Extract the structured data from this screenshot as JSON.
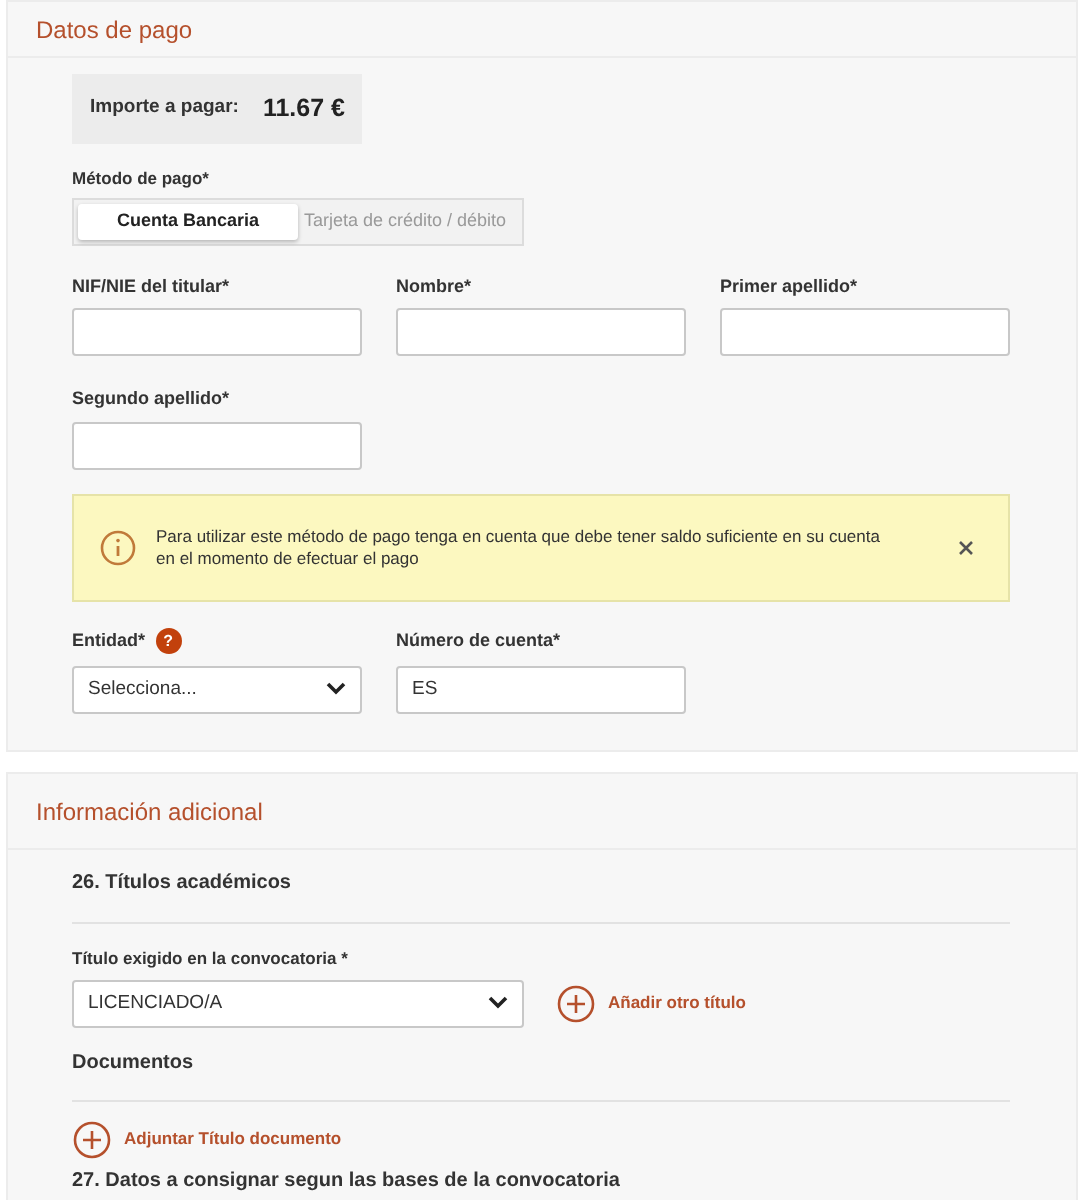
{
  "payment": {
    "title": "Datos de pago",
    "amount": {
      "label": "Importe a pagar:",
      "value": "11.67 €"
    },
    "method": {
      "label": "Método de pago*",
      "options": [
        {
          "label": "Cuenta Bancaria",
          "selected": true
        },
        {
          "label": "Tarjeta de crédito / débito",
          "selected": false
        }
      ]
    },
    "fields": [
      {
        "label": "NIF/NIE del titular*"
      },
      {
        "label": "Nombre*"
      },
      {
        "label": "Primer apellido*"
      },
      {
        "label": "Segundo apellido*"
      }
    ],
    "alert": {
      "text": "Para utilizar este método de pago tenga en cuenta que debe tener saldo suficiente en su cuenta en el momento de efectuar el pago"
    },
    "entity": {
      "label": "Entidad*",
      "help": "?",
      "value": "Selecciona..."
    },
    "account": {
      "label": "Número de cuenta*",
      "value": "ES"
    }
  },
  "additional": {
    "title": "Información adicional",
    "section_26": "26. Títulos académicos",
    "degree": {
      "label": "Título exigido en la convocatoria *",
      "value": "LICENCIADO/A"
    },
    "add_degree": "Añadir otro título",
    "documents": "Documentos",
    "attach": "Adjuntar Título documento",
    "section_27": "27. Datos a consignar segun las bases de la convocatoria"
  }
}
